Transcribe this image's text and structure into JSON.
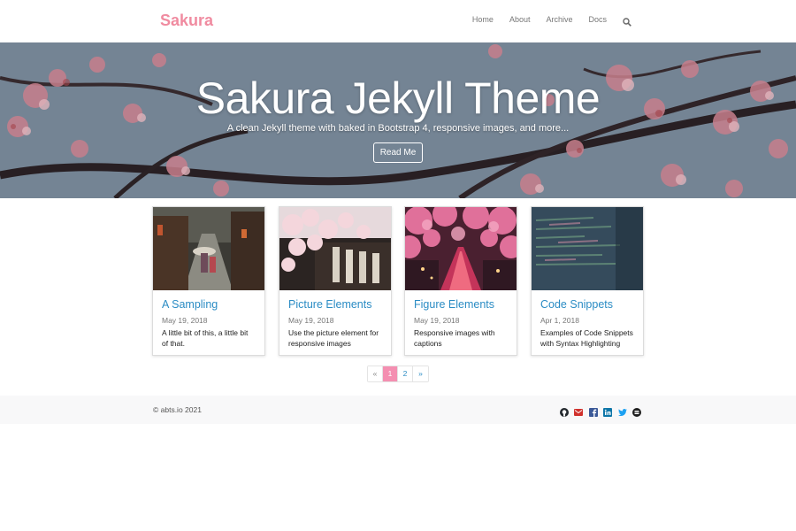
{
  "navbar": {
    "brand": "Sakura",
    "links": [
      "Home",
      "About",
      "Archive",
      "Docs"
    ],
    "search_icon": "search-icon"
  },
  "hero": {
    "title": "Sakura Jekyll Theme",
    "subtitle": "A clean Jekyll theme with baked in Bootstrap 4, responsive images, and more...",
    "button": "Read Me"
  },
  "posts": [
    {
      "title": "A Sampling",
      "date": "May 19, 2018",
      "description": "A little bit of this, a little bit of that."
    },
    {
      "title": "Picture Elements",
      "date": "May 19, 2018",
      "description": "Use the picture element for responsive images"
    },
    {
      "title": "Figure Elements",
      "date": "May 19, 2018",
      "description": "Responsive images with captions"
    },
    {
      "title": "Code Snippets",
      "date": "Apr 1, 2018",
      "description": "Examples of Code Snippets with Syntax Highlighting"
    }
  ],
  "pagination": {
    "prev": "«",
    "pages": [
      "1",
      "2"
    ],
    "active": "1",
    "next": "»"
  },
  "footer": {
    "copyright": "© abts.io 2021",
    "social_icons": [
      "github-icon",
      "email-icon",
      "facebook-icon",
      "linkedin-icon",
      "twitter-icon",
      "stackexchange-icon"
    ]
  },
  "colors": {
    "brand": "#f08ba0",
    "link": "#2b8cc4",
    "pagination_active": "#f48fb1",
    "footer_bg": "#f8f8f9"
  }
}
